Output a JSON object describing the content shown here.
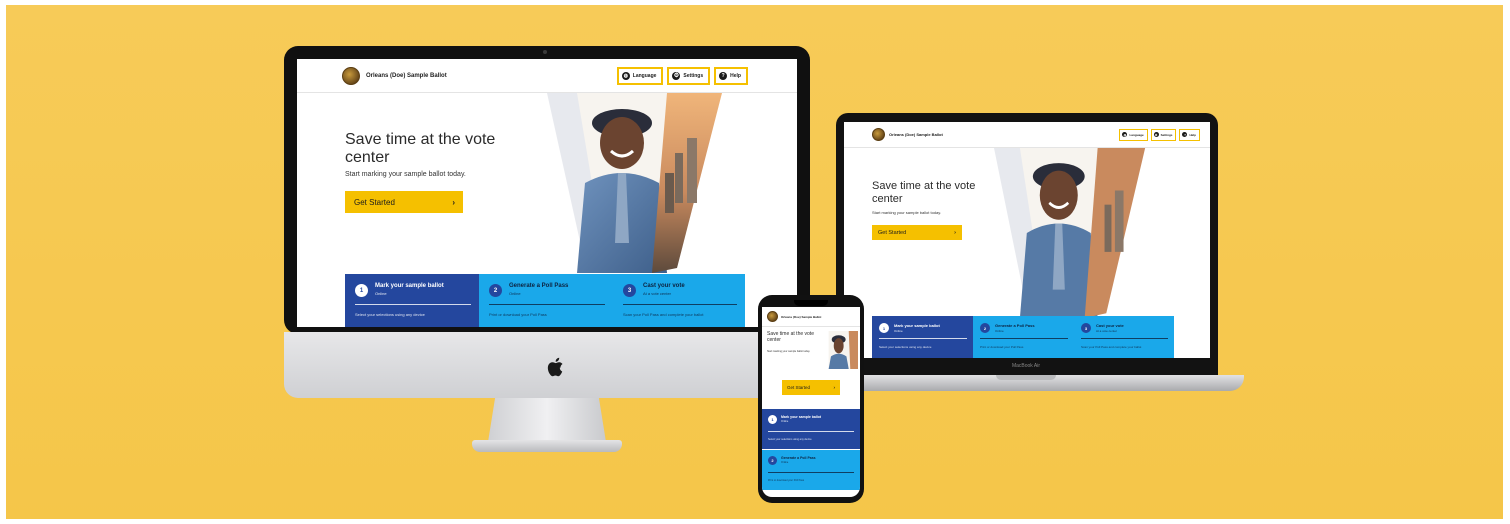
{
  "site": {
    "title": "Orleans (Doe) Sample Ballot",
    "header_buttons": [
      {
        "label": "Language",
        "icon": "globe-icon"
      },
      {
        "label": "Settings",
        "icon": "gear-icon"
      },
      {
        "label": "Help",
        "icon": "help-icon"
      }
    ],
    "hero": {
      "title_desktop": "Save time at the vote center",
      "subtitle": "Start marking your sample ballot today.",
      "cta_label": "Get Started",
      "cta_arrow": "›"
    },
    "steps": [
      {
        "number": "1",
        "title": "Mark your sample ballot",
        "subtitle": "Online",
        "description": "Select your selections using any device"
      },
      {
        "number": "2",
        "title": "Generate a Poll Pass",
        "subtitle": "Online",
        "description": "Print or download your Poll Pass"
      },
      {
        "number": "3",
        "title": "Cast your vote",
        "subtitle": "At a vote center",
        "description": "Scan your Poll Pass and complete your ballot"
      }
    ]
  },
  "laptop_brand": "MacBook Air",
  "colors": {
    "background": "#f5c649",
    "accent_yellow": "#f5c000",
    "step_dark_blue": "#24479e",
    "step_light_blue": "#1aa8ea"
  }
}
